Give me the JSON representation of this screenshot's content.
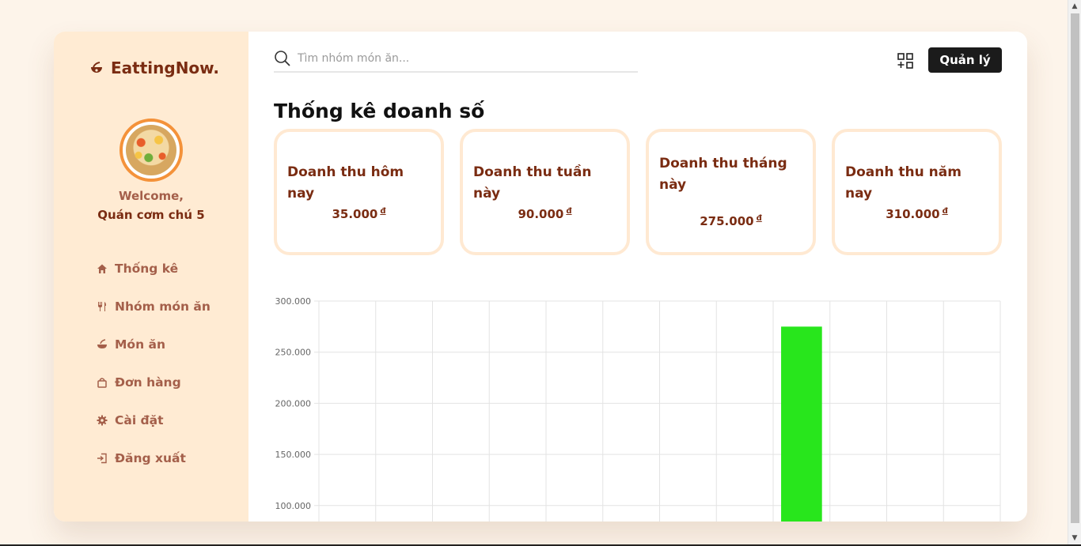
{
  "brand": {
    "name": "EattingNow."
  },
  "user": {
    "welcome": "Welcome,",
    "shop_name": "Quán cơm chú 5"
  },
  "sidebar": {
    "items": [
      {
        "label": "Thống kê",
        "icon": "home-icon"
      },
      {
        "label": "Nhóm món ăn",
        "icon": "utensils-icon"
      },
      {
        "label": "Món ăn",
        "icon": "bowl-icon"
      },
      {
        "label": "Đơn hàng",
        "icon": "shopping-bag-icon"
      },
      {
        "label": "Cài đặt",
        "icon": "gear-icon"
      },
      {
        "label": "Đăng xuất",
        "icon": "logout-icon"
      }
    ]
  },
  "header": {
    "search_placeholder": "Tìm nhóm món ăn...",
    "manage_label": "Quản lý"
  },
  "page": {
    "title": "Thống kê doanh số"
  },
  "stats": [
    {
      "label": "Doanh thu hôm nay",
      "value": "35.000",
      "currency": "đ"
    },
    {
      "label": "Doanh thu tuần này",
      "value": "90.000",
      "currency": "đ"
    },
    {
      "label": "Doanh thu tháng này",
      "value": "275.000",
      "currency": "đ"
    },
    {
      "label": "Doanh thu năm nay",
      "value": "310.000",
      "currency": "đ"
    }
  ],
  "colors": {
    "accent": "#7a2c12",
    "bar": "#28e61c",
    "sidebar_bg": "#ffebd3"
  },
  "chart_data": {
    "type": "bar",
    "categories": [
      "",
      "",
      "",
      "",
      "",
      "",
      "",
      "",
      "",
      "",
      "",
      ""
    ],
    "values": [
      0,
      0,
      0,
      0,
      0,
      0,
      0,
      0,
      275000,
      0,
      0,
      0
    ],
    "y_ticks": [
      "300.000",
      "250.000",
      "200.000",
      "150.000",
      "100.000"
    ],
    "ylim": [
      100000,
      300000
    ],
    "grid": true
  }
}
